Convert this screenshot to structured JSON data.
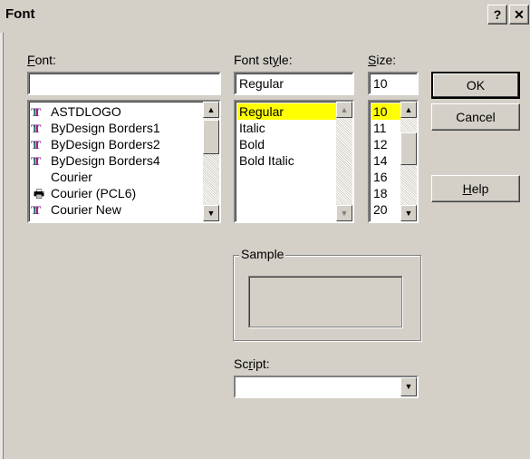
{
  "window": {
    "title": "Font",
    "help_button": "?",
    "close_button": "✕"
  },
  "font": {
    "label": "Font:",
    "label_accel": "F",
    "label_rest": "ont:",
    "value": "",
    "items": [
      {
        "name": "ASTDLOGO",
        "icon": "truetype-icon"
      },
      {
        "name": "ByDesign Borders1",
        "icon": "truetype-icon"
      },
      {
        "name": "ByDesign Borders2",
        "icon": "truetype-icon"
      },
      {
        "name": "ByDesign Borders4",
        "icon": "truetype-icon"
      },
      {
        "name": "Courier",
        "icon": "none"
      },
      {
        "name": "Courier (PCL6)",
        "icon": "printer-font-icon"
      },
      {
        "name": "Courier New",
        "icon": "truetype-icon"
      }
    ]
  },
  "style": {
    "label_pre": "Font st",
    "label_accel": "y",
    "label_rest": "le:",
    "value": "Regular",
    "items": [
      "Regular",
      "Italic",
      "Bold",
      "Bold Italic"
    ],
    "selected": "Regular"
  },
  "size": {
    "label_accel": "S",
    "label_rest": "ize:",
    "value": "10",
    "items": [
      "10",
      "11",
      "12",
      "14",
      "16",
      "18",
      "20"
    ],
    "selected": "10"
  },
  "buttons": {
    "ok": "OK",
    "cancel": "Cancel",
    "help_accel": "H",
    "help_rest": "elp"
  },
  "sample": {
    "label": "Sample"
  },
  "script": {
    "label_pre": "Sc",
    "label_accel": "r",
    "label_rest": "ipt:",
    "value": ""
  },
  "colors": {
    "dialog_bg": "#d4d0c8",
    "selection": "#ffff00"
  }
}
